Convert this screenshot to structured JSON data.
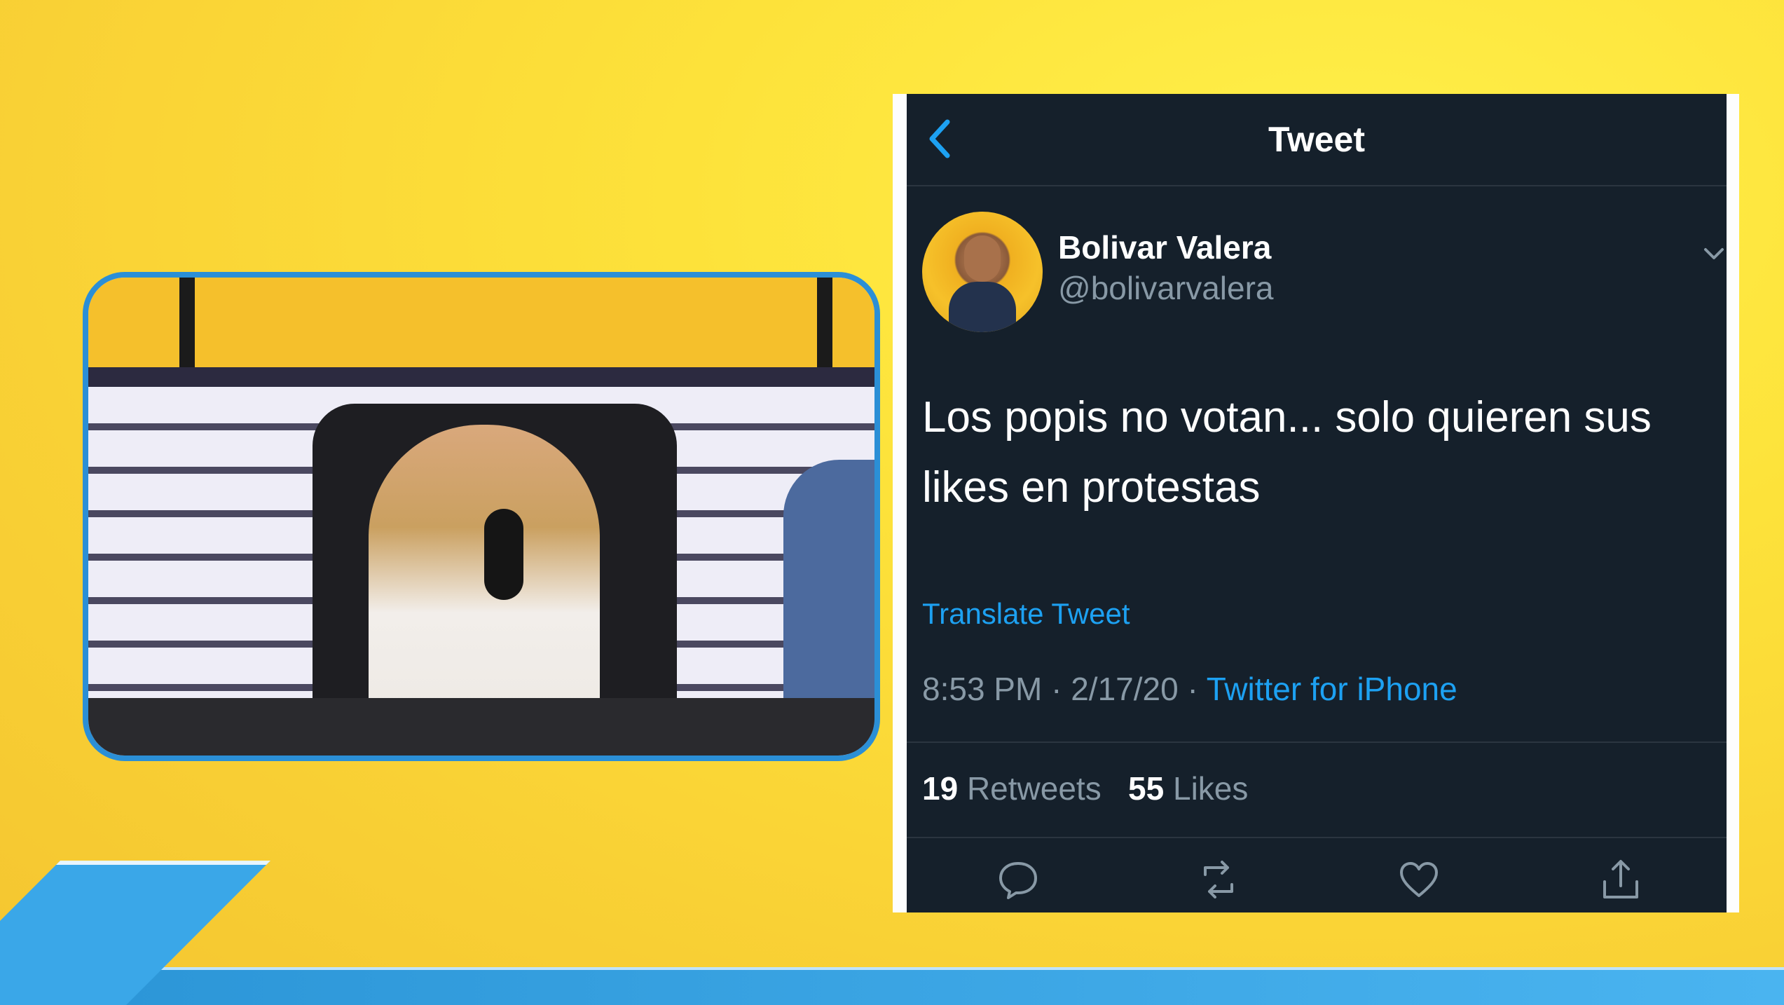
{
  "tweet": {
    "header_title": "Tweet",
    "author_name": "Bolivar Valera",
    "author_handle": "@bolivarvalera",
    "text": "Los popis no votan... solo quieren sus likes en protestas",
    "translate_label": "Translate Tweet",
    "time": "8:53 PM",
    "date": "2/17/20",
    "separator": "·",
    "source": "Twitter for iPhone",
    "retweets_count": "19",
    "retweets_label": "Retweets",
    "likes_count": "55",
    "likes_label": "Likes"
  },
  "icons": {
    "back": "back-chevron-icon",
    "menu": "chevron-down-icon",
    "reply": "reply-icon",
    "retweet": "retweet-icon",
    "like": "heart-icon",
    "share": "share-icon"
  },
  "colors": {
    "background": "#f9d135",
    "tweet_bg": "#15202b",
    "accent": "#1da1f2",
    "secondary_text": "#8899a6",
    "frame_border": "#2b8fd6"
  }
}
